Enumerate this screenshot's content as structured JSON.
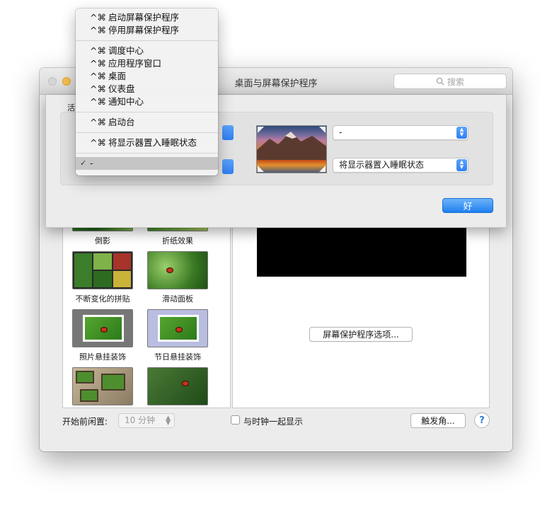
{
  "window": {
    "title": "桌面与屏幕保护程序",
    "search_placeholder": "搜索"
  },
  "screensavers": [
    {
      "label": "倒影"
    },
    {
      "label": "折纸效果"
    },
    {
      "label": "不断变化的拼贴"
    },
    {
      "label": "滑动面板"
    },
    {
      "label": "照片悬挂装饰"
    },
    {
      "label": "节日悬挂装饰"
    }
  ],
  "preview": {
    "options_button": "屏幕保护程序选项..."
  },
  "bottom": {
    "idle_label": "开始前闲置:",
    "idle_value": "10 分钟",
    "clock_label": "与时钟一起显示",
    "hot_corners_button": "触发角...",
    "help": "?"
  },
  "sheet": {
    "section_label": "活",
    "top_right_value": "-",
    "bottom_right_value": "将显示器置入睡眠状态",
    "ok_button": "好"
  },
  "menu": {
    "shortcut": "^⌘",
    "groups": [
      [
        "启动屏幕保护程序",
        "停用屏幕保护程序"
      ],
      [
        "调度中心",
        "应用程序窗口",
        "桌面",
        "仪表盘",
        "通知中心"
      ],
      [
        "启动台"
      ],
      [
        "将显示器置入睡眠状态"
      ]
    ],
    "selected_item": "-",
    "check": "✓"
  }
}
